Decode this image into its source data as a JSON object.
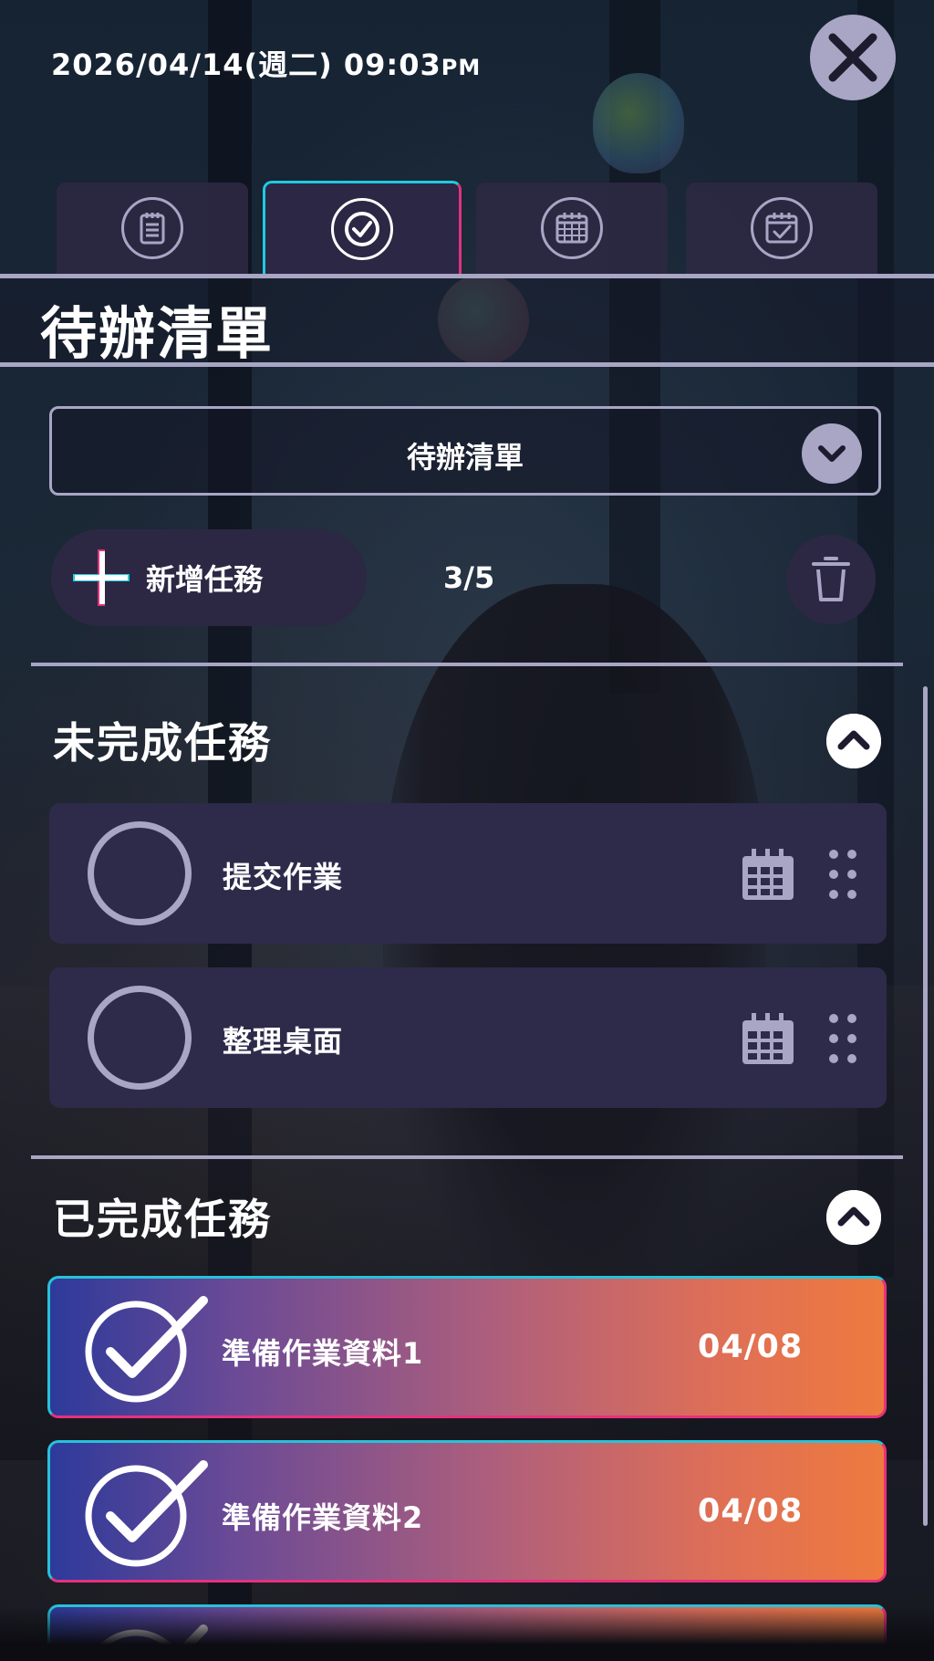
{
  "header": {
    "date_time": "2026/04/14(週二)  09:03",
    "meridiem": "PM",
    "close_icon": "close-x-icon"
  },
  "tabs": [
    {
      "icon": "notepad-icon",
      "active": false
    },
    {
      "icon": "check-circle-icon",
      "active": true
    },
    {
      "icon": "calendar-grid-icon",
      "active": false
    },
    {
      "icon": "calendar-check-icon",
      "active": false
    }
  ],
  "page": {
    "title": "待辦清單"
  },
  "list_selector": {
    "selected": "待辦清單",
    "icon": "chevron-down-icon"
  },
  "actions": {
    "add_task_label": "新增任務",
    "task_count": "3/5",
    "trash_icon": "trash-icon"
  },
  "incomplete": {
    "title": "未完成任務",
    "toggle_icon": "chevron-up-icon",
    "items": [
      {
        "name": "提交作業"
      },
      {
        "name": "整理桌面"
      }
    ]
  },
  "completed": {
    "title": "已完成任務",
    "toggle_icon": "chevron-up-icon",
    "items": [
      {
        "name": "準備作業資料1",
        "date": "04/08"
      },
      {
        "name": "準備作業資料2",
        "date": "04/08"
      }
    ]
  },
  "colors": {
    "accent_cyan": "#1ecbe1",
    "accent_pink": "#e0327d",
    "panel": "#2e2a4a",
    "muted": "#a8a6c4",
    "gradient_start": "#2d3a9a",
    "gradient_end": "#ee7a3e"
  }
}
